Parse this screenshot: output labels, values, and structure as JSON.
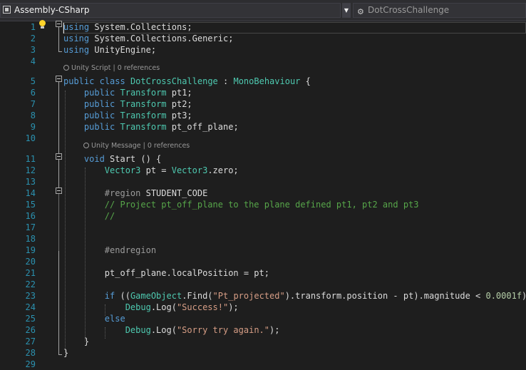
{
  "window": {
    "project_dropdown": "Assembly-CSharp",
    "project_icon": "csharp-project-icon",
    "member_dropdown": "DotCrossChallenge",
    "member_icon": "class-icon"
  },
  "codelens": {
    "class": "Unity Script | 0 references",
    "method": "Unity Message | 0 references"
  },
  "line_numbers": [
    "1",
    "2",
    "3",
    "4",
    "5",
    "6",
    "7",
    "8",
    "9",
    "10",
    "11",
    "12",
    "13",
    "14",
    "15",
    "16",
    "17",
    "18",
    "19",
    "20",
    "21",
    "22",
    "23",
    "24",
    "25",
    "26",
    "27",
    "28",
    "29"
  ],
  "lines": [
    [
      {
        "t": "using",
        "c": "kw"
      },
      {
        "t": " System.Collections;"
      }
    ],
    [
      {
        "t": "using",
        "c": "kw"
      },
      {
        "t": " System.Collections.Generic;"
      }
    ],
    [
      {
        "t": "using",
        "c": "kw"
      },
      {
        "t": " UnityEngine;"
      }
    ],
    [],
    [
      {
        "t": "public",
        "c": "kw"
      },
      {
        "t": " "
      },
      {
        "t": "class",
        "c": "kw"
      },
      {
        "t": " "
      },
      {
        "t": "DotCrossChallenge",
        "c": "ty"
      },
      {
        "t": " : "
      },
      {
        "t": "MonoBehaviour",
        "c": "ty"
      },
      {
        "t": " {"
      }
    ],
    [
      {
        "t": "    "
      },
      {
        "t": "public",
        "c": "kw"
      },
      {
        "t": " "
      },
      {
        "t": "Transform",
        "c": "ty"
      },
      {
        "t": " pt1;"
      }
    ],
    [
      {
        "t": "    "
      },
      {
        "t": "public",
        "c": "kw"
      },
      {
        "t": " "
      },
      {
        "t": "Transform",
        "c": "ty"
      },
      {
        "t": " pt2;"
      }
    ],
    [
      {
        "t": "    "
      },
      {
        "t": "public",
        "c": "kw"
      },
      {
        "t": " "
      },
      {
        "t": "Transform",
        "c": "ty"
      },
      {
        "t": " pt3;"
      }
    ],
    [
      {
        "t": "    "
      },
      {
        "t": "public",
        "c": "kw"
      },
      {
        "t": " "
      },
      {
        "t": "Transform",
        "c": "ty"
      },
      {
        "t": " pt_off_plane;"
      }
    ],
    [],
    [
      {
        "t": "    "
      },
      {
        "t": "void",
        "c": "kw"
      },
      {
        "t": " Start () {"
      }
    ],
    [
      {
        "t": "        "
      },
      {
        "t": "Vector3",
        "c": "ty"
      },
      {
        "t": " pt = "
      },
      {
        "t": "Vector3",
        "c": "ty"
      },
      {
        "t": ".zero;"
      }
    ],
    [],
    [
      {
        "t": "        "
      },
      {
        "t": "#region",
        "c": "pp"
      },
      {
        "t": " STUDENT_CODE"
      }
    ],
    [
      {
        "t": "        "
      },
      {
        "t": "// Project pt_off_plane to the plane defined pt1, pt2 and pt3",
        "c": "cm"
      }
    ],
    [
      {
        "t": "        "
      },
      {
        "t": "//",
        "c": "cm"
      }
    ],
    [],
    [],
    [
      {
        "t": "        "
      },
      {
        "t": "#endregion",
        "c": "pp"
      }
    ],
    [],
    [
      {
        "t": "        pt_off_plane.localPosition = pt;"
      }
    ],
    [],
    [
      {
        "t": "        "
      },
      {
        "t": "if",
        "c": "kw"
      },
      {
        "t": " (("
      },
      {
        "t": "GameObject",
        "c": "ty"
      },
      {
        "t": ".Find("
      },
      {
        "t": "\"Pt_projected\"",
        "c": "st"
      },
      {
        "t": ").transform.position - pt).magnitude < "
      },
      {
        "t": "0.0001f",
        "c": "nu"
      },
      {
        "t": ")"
      }
    ],
    [
      {
        "t": "            "
      },
      {
        "t": "Debug",
        "c": "ty"
      },
      {
        "t": ".Log("
      },
      {
        "t": "\"Success!\"",
        "c": "st"
      },
      {
        "t": ");"
      }
    ],
    [
      {
        "t": "        "
      },
      {
        "t": "else",
        "c": "kw"
      }
    ],
    [
      {
        "t": "            "
      },
      {
        "t": "Debug",
        "c": "ty"
      },
      {
        "t": ".Log("
      },
      {
        "t": "\"Sorry try again.\"",
        "c": "st"
      },
      {
        "t": ");"
      }
    ],
    [
      {
        "t": "    }"
      }
    ],
    [
      {
        "t": "}"
      }
    ],
    []
  ],
  "colors": {
    "background": "#1e1e1e",
    "keyword": "#569cd6",
    "type": "#4ec9b0",
    "string": "#d69d85",
    "comment": "#57a64a",
    "number": "#b5cea8",
    "line_number": "#2b91af"
  },
  "icons": {
    "lightbulb": "lightbulb-icon",
    "fold": "collapse-icon",
    "codelens": "unity-icon"
  }
}
